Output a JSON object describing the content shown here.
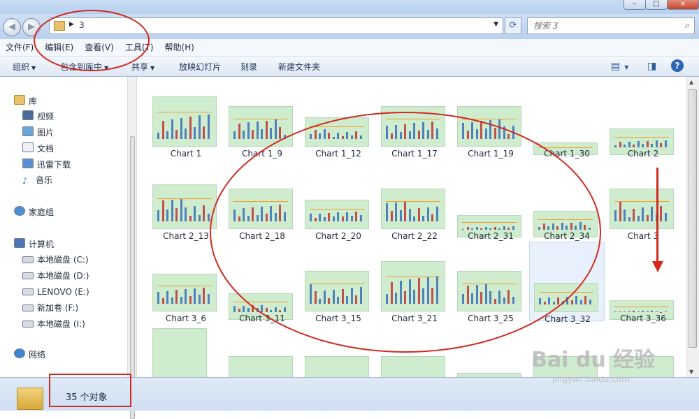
{
  "window": {
    "controls": [
      "–",
      "□",
      "×"
    ]
  },
  "address": {
    "crumb": "3",
    "search_placeholder": "搜索 3"
  },
  "menu": [
    "文件(F)",
    "编辑(E)",
    "查看(V)",
    "工具(T)",
    "帮助(H)"
  ],
  "toolbar": {
    "organize": "组织",
    "include": "包含到库中",
    "share": "共享",
    "slideshow": "放映幻灯片",
    "burn": "刻录",
    "new_folder": "新建文件夹"
  },
  "nav": {
    "library": "库",
    "video": "视频",
    "pictures": "图片",
    "documents": "文档",
    "thunder": "迅雷下载",
    "music": "音乐",
    "homegroup": "家庭组",
    "computer": "计算机",
    "drives": [
      "本地磁盘 (C:)",
      "本地磁盘 (D:)",
      "LENOVO (E:)",
      "新加卷 (F:)",
      "本地磁盘 (I:)"
    ],
    "network": "网络"
  },
  "files": [
    "Chart 1",
    "Chart 1_9",
    "Chart 1_12",
    "Chart 1_17",
    "Chart 1_19",
    "Chart 1_30",
    "Chart 2",
    "Chart 2_13",
    "Chart 2_18",
    "Chart 2_20",
    "Chart 2_22",
    "Chart 2_31",
    "Chart 2_34",
    "Chart 3",
    "Chart 3_6",
    "Chart 3_11",
    "Chart 3_15",
    "Chart 3_21",
    "Chart 3_25",
    "Chart 3_32",
    "Chart 3_36"
  ],
  "status": {
    "count": "35 个对象"
  },
  "watermark": {
    "brand": "Bai du 经验",
    "url": "jingyan.baidu.com"
  },
  "colors": {
    "annotation": "#d2281e",
    "thumb_bg": "#cfeccf"
  }
}
